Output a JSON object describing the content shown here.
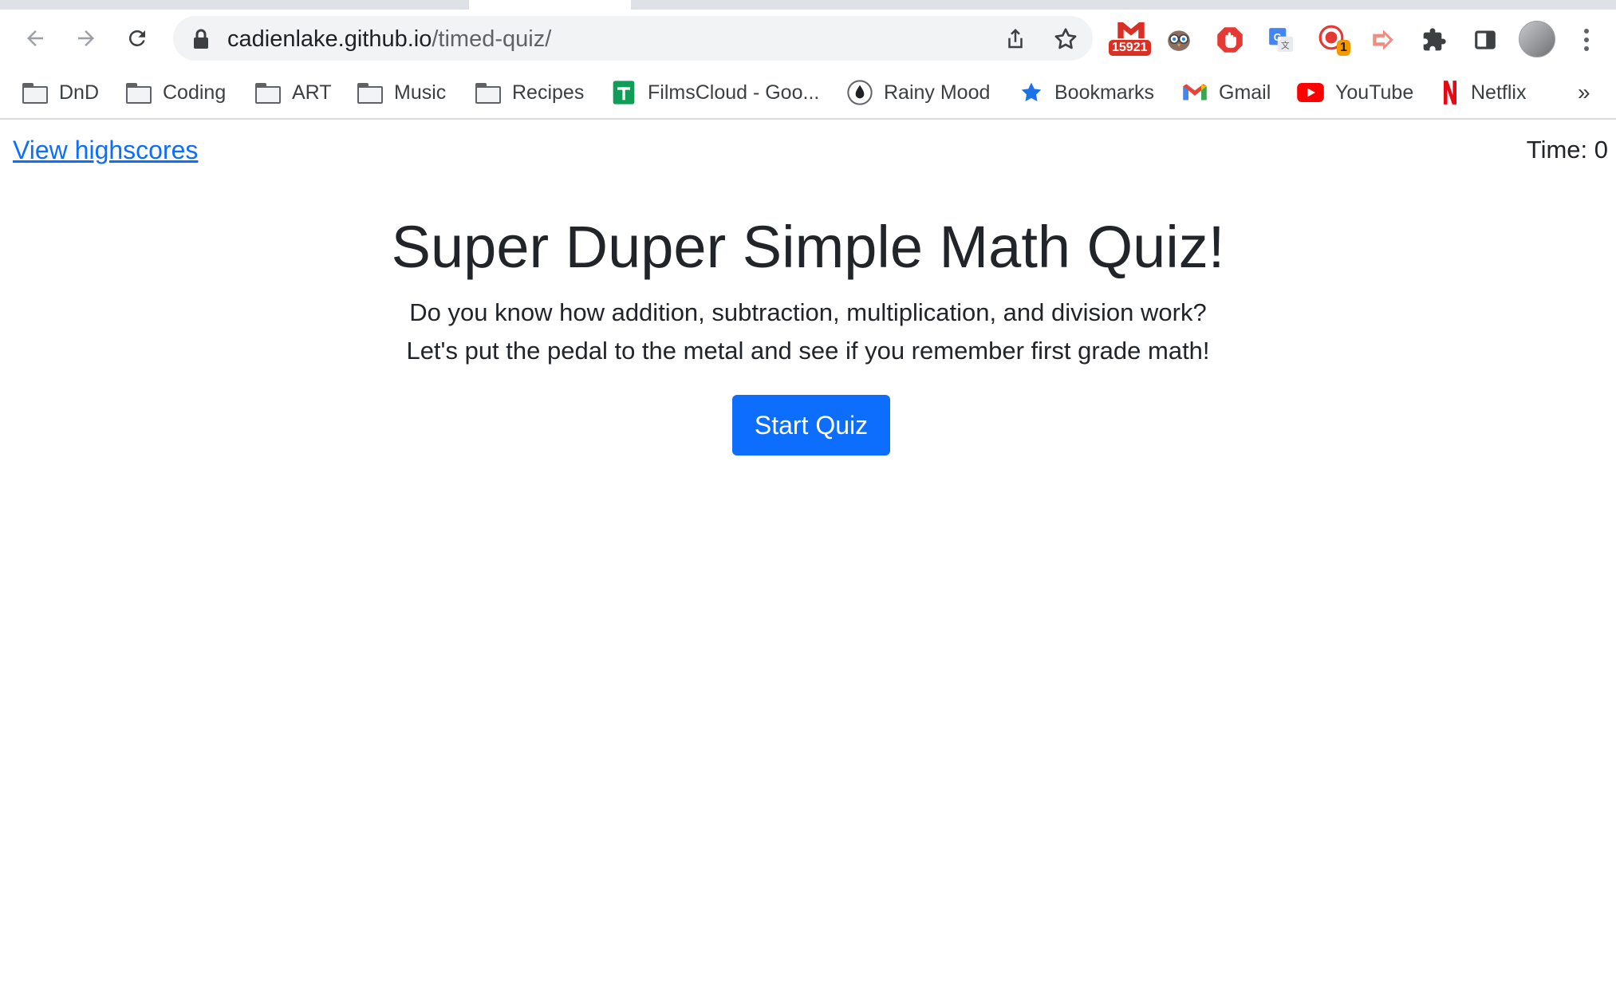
{
  "browser": {
    "url_host": "cadienlake.github.io",
    "url_path": "/timed-quiz/",
    "extensions": {
      "gmail_checker_badge": "15921",
      "recorder_badge": "1"
    },
    "bookmarks": [
      {
        "label": "DnD",
        "icon": "folder-icon"
      },
      {
        "label": "Coding",
        "icon": "folder-icon"
      },
      {
        "label": "ART",
        "icon": "folder-icon"
      },
      {
        "label": "Music",
        "icon": "folder-icon"
      },
      {
        "label": "Recipes",
        "icon": "folder-icon"
      },
      {
        "label": "FilmsCloud - Goo...",
        "icon": "google-sheets-icon"
      },
      {
        "label": "Rainy Mood",
        "icon": "rainy-mood-icon"
      },
      {
        "label": "Bookmarks",
        "icon": "star-icon"
      },
      {
        "label": "Gmail",
        "icon": "gmail-icon"
      },
      {
        "label": "YouTube",
        "icon": "youtube-icon"
      },
      {
        "label": "Netflix",
        "icon": "netflix-icon"
      }
    ],
    "overflow_label": "»"
  },
  "page": {
    "highscores_link": "View highscores",
    "timer": "Time: 0",
    "title": "Super Duper Simple Math Quiz!",
    "description_line1": "Do you know how addition, subtraction, multiplication, and division work?",
    "description_line2": "Let's put the pedal to the metal and see if you remember first grade math!",
    "start_button": "Start Quiz"
  },
  "colors": {
    "primary": "#0d6efd",
    "text": "#212529",
    "link": "#0d6efd"
  }
}
